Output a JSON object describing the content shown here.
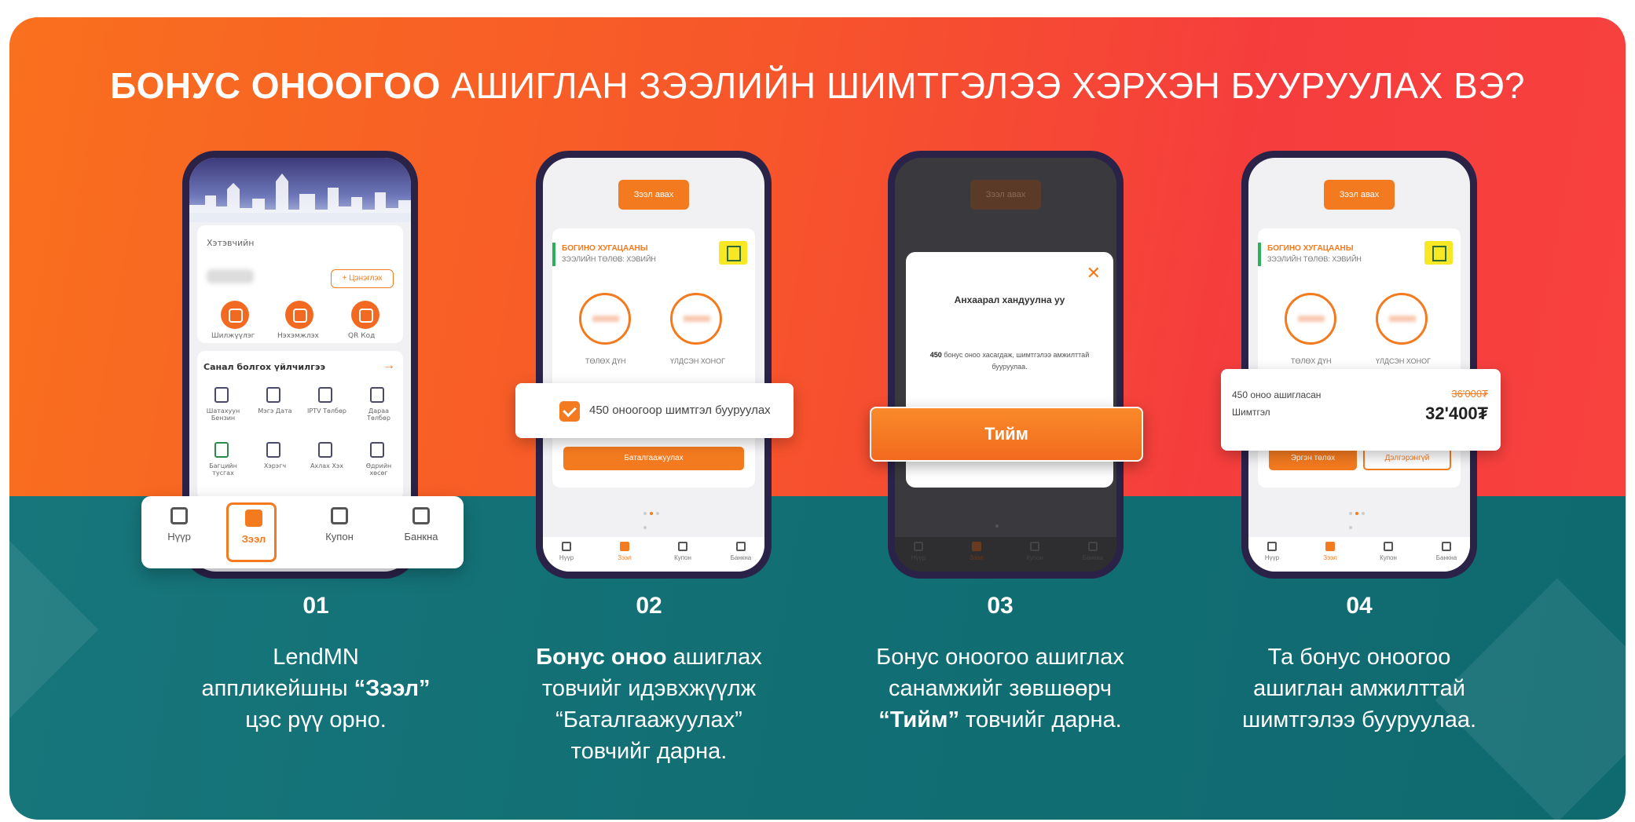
{
  "headline": {
    "bold": "БОНУС ОНООГОО",
    "rest": " АШИГЛАН ЗЭЭЛИЙН ШИМТГЭЛЭЭ ХЭРХЭН БУУРУУЛАХ ВЭ?"
  },
  "colors": {
    "orange_top": "#f7562a",
    "teal_bottom": "#116f74",
    "accent": "#f47a1f"
  },
  "phone1": {
    "greeting": "Хэтэвчийн",
    "add_button": "+ Цэнэглэх",
    "quick_actions": [
      "Шилжүүлэг",
      "Нэхэмжлэх",
      "QR Код"
    ],
    "services_title": "Санал болгох үйлчилгээ",
    "services": [
      "Шатахуун Бензин",
      "Мэгэ Дата",
      "IPTV Төлбөр",
      "Дараа Төлбөр",
      "Багцийн тусгах",
      "Хэрэгч",
      "Ахлах Хэх",
      "Өдрийн хөсөг"
    ],
    "nav": [
      {
        "label": "Нүүр",
        "icon": "home-icon"
      },
      {
        "label": "Зээл",
        "icon": "loan-icon"
      },
      {
        "label": "Купон",
        "icon": "coupon-icon"
      },
      {
        "label": "Банкна",
        "icon": "bag-icon"
      }
    ]
  },
  "phone2": {
    "top_button": "Зээл авах",
    "card_title": "БОГИНО ХУГАЦААНЫ",
    "card_sub": "ЗЭЭЛИЙН ТӨЛӨВ: ХЭВИЙН",
    "ring1_label": "ТӨЛӨХ ДҮН",
    "ring2_label": "ҮЛДСЭН ХОНОГ",
    "checkbox_label": "450 оноогоор шимтгэл бууруулах",
    "confirm_button": "Баталгаажуулах",
    "nav": [
      "Нүүр",
      "Зээл",
      "Купон",
      "Банкна"
    ]
  },
  "phone3": {
    "top_button": "Зээл авах",
    "modal_title": "Анхаарал хандуулна уу",
    "modal_body_bold": "450",
    "modal_body": " бонус оноо хасагдаж, шимтгэлээ амжилттай бууруулаа.",
    "yes_button": "Тийм",
    "nav": [
      "Нүүр",
      "Зээл",
      "Купон",
      "Банкна"
    ]
  },
  "phone4": {
    "top_button": "Зээл авах",
    "card_title": "БОГИНО ХУГАЦААНЫ",
    "card_sub": "ЗЭЭЛИЙН ТӨЛӨВ: ХЭВИЙН",
    "ring1_label": "ТӨЛӨХ ДҮН",
    "ring2_label": "ҮЛДСЭН ХОНОГ",
    "fee_line1": "450 оноо ашигласан",
    "fee_line2": "Шимтгэл",
    "fee_old": "36'000₮",
    "fee_new": "32'400₮",
    "btn_left": "Эргэн төлөх",
    "btn_right": "Дэлгэрэнгүй",
    "nav": [
      "Нүүр",
      "Зээл",
      "Купон",
      "Банкна"
    ]
  },
  "steps": [
    {
      "num": "01",
      "lines": [
        "LendMN",
        "аппликейшны ",
        "“Зээл”",
        "цэс рүү орно."
      ]
    },
    {
      "num": "02",
      "lines": [
        "Бонус оноо",
        " ашиглах",
        "товчийг идэвхжүүлж",
        "“Баталгаажуулах”",
        "товчийг дарна."
      ]
    },
    {
      "num": "03",
      "lines": [
        "Бонус оноогоо ашиглах",
        "санамжийг зөвшөөрч",
        "“Тийм”",
        " товчийг дарна."
      ]
    },
    {
      "num": "04",
      "lines": [
        "Та бонус оноогоо",
        "ашиглан амжилттай",
        "шимтгэлээ бууруулаа."
      ]
    }
  ]
}
